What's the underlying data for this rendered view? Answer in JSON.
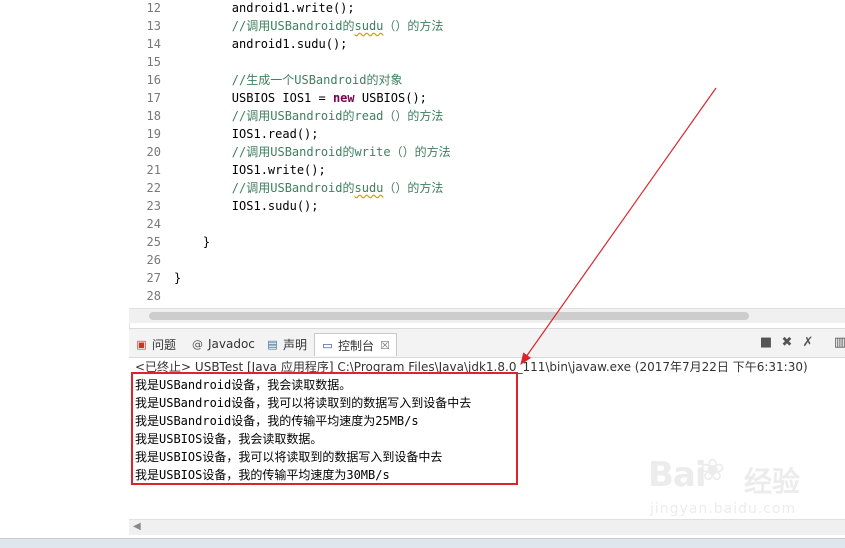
{
  "editor": {
    "lines": [
      {
        "n": "12",
        "text": "        android1.write();",
        "kind": "code"
      },
      {
        "n": "13",
        "pre": "        //调用USBandroid的",
        "sq": "sudu",
        "post": "（）的方法",
        "kind": "comment"
      },
      {
        "n": "14",
        "text": "        android1.sudu();",
        "kind": "code"
      },
      {
        "n": "15",
        "text": "",
        "kind": "code"
      },
      {
        "n": "16",
        "text": "        //生成一个USBandroid的对象",
        "kind": "comment"
      },
      {
        "n": "17",
        "pre": "        USBIOS IOS1 = ",
        "kw": "new",
        "post": " USBIOS();",
        "kind": "kwline"
      },
      {
        "n": "18",
        "text": "        //调用USBandroid的read（）的方法",
        "kind": "comment"
      },
      {
        "n": "19",
        "text": "        IOS1.read();",
        "kind": "code"
      },
      {
        "n": "20",
        "text": "        //调用USBandroid的write（）的方法",
        "kind": "comment"
      },
      {
        "n": "21",
        "text": "        IOS1.write();",
        "kind": "code"
      },
      {
        "n": "22",
        "pre": "        //调用USBandroid的",
        "sq": "sudu",
        "post": "（）的方法",
        "kind": "comment"
      },
      {
        "n": "23",
        "text": "        IOS1.sudu();",
        "kind": "code"
      },
      {
        "n": "24",
        "text": "",
        "kind": "code"
      },
      {
        "n": "25",
        "text": "    }",
        "kind": "code"
      },
      {
        "n": "26",
        "text": "",
        "kind": "code"
      },
      {
        "n": "27",
        "text": "}",
        "kind": "code"
      },
      {
        "n": "28",
        "text": "",
        "kind": "code"
      }
    ]
  },
  "console": {
    "tabs": [
      {
        "icon": "problems-icon",
        "label": "问题"
      },
      {
        "icon": "javadoc-icon",
        "label": "Javadoc"
      },
      {
        "icon": "declaration-icon",
        "label": "声明"
      },
      {
        "icon": "console-icon",
        "label": "控制台",
        "active": true
      }
    ],
    "tab_close": "☒",
    "status": "<已终止> USBTest [Java 应用程序] C:\\Program Files\\Java\\jdk1.8.0_111\\bin\\javaw.exe (2017年7月22日 下午6:31:30)",
    "output": [
      "我是USBandroid设备，我会读取数据。",
      "我是USBandroid设备，我可以将读取到的数据写入到设备中去",
      "我是USBandroid设备，我的传输平均速度为25MB/s",
      "我是USBIOS设备，我会读取数据。",
      "我是USBIOS设备，我可以将读取到的数据写入到设备中去",
      "我是USBIOS设备，我的传输平均速度为30MB/s"
    ]
  },
  "watermark": {
    "logo": "Bai",
    "logo_cn": "经验",
    "url": "jingyan.baidu.com"
  },
  "colors": {
    "annotation": "#d9262c",
    "comment": "#3f7f5f",
    "keyword": "#7f0055"
  }
}
